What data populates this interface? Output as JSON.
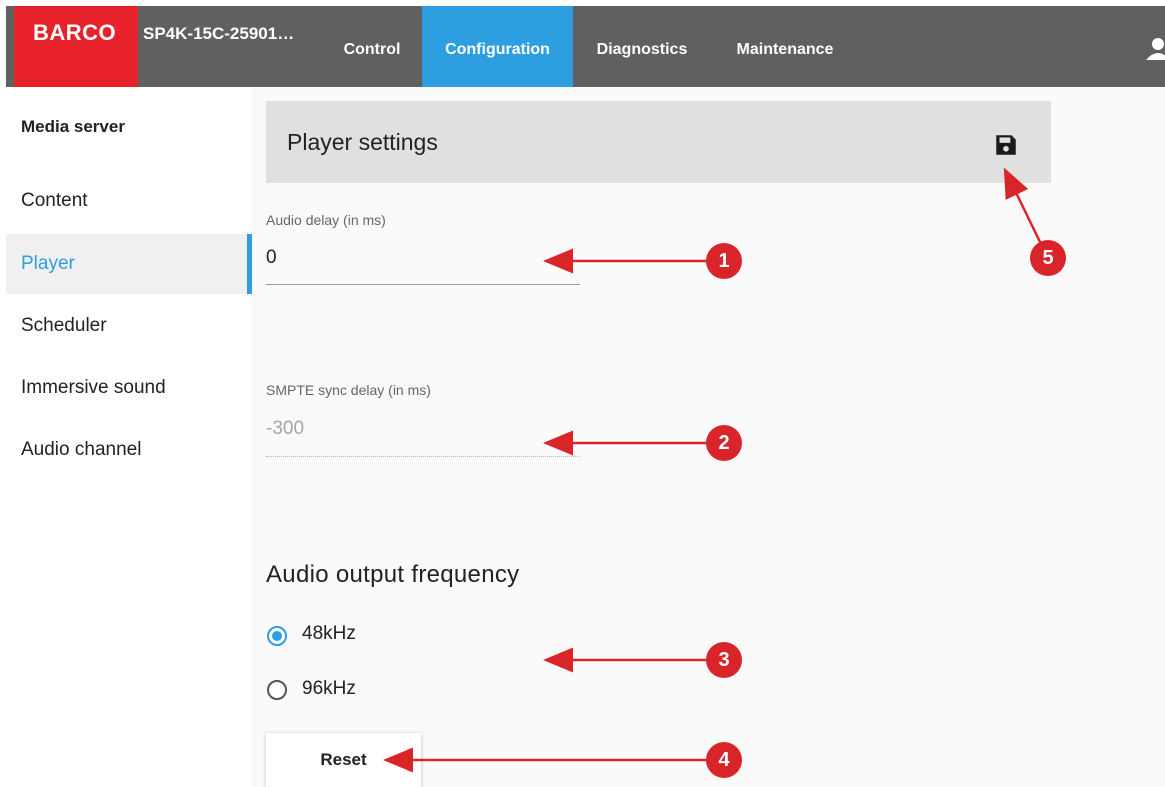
{
  "header": {
    "logo_text": "BARCO",
    "device_name": "SP4K-15C-25901…",
    "tabs": [
      {
        "label": "Control"
      },
      {
        "label": "Configuration"
      },
      {
        "label": "Diagnostics"
      },
      {
        "label": "Maintenance"
      }
    ],
    "active_tab": "Configuration",
    "user_icon": "user-icon"
  },
  "sidebar": {
    "section_title": "Media server",
    "items": [
      {
        "label": "Content"
      },
      {
        "label": "Player"
      },
      {
        "label": "Scheduler"
      },
      {
        "label": "Immersive sound"
      },
      {
        "label": "Audio channel"
      }
    ],
    "active_item": "Player"
  },
  "main": {
    "title": "Player settings",
    "save_icon": "save-icon",
    "audio_delay": {
      "label": "Audio delay (in ms)",
      "value": "0"
    },
    "smpte_delay": {
      "label": "SMPTE sync delay (in ms)",
      "value": "-300"
    },
    "frequency_title": "Audio output frequency",
    "frequency_options": [
      {
        "label": "48kHz",
        "checked": true
      },
      {
        "label": "96kHz",
        "checked": false
      }
    ],
    "reset_label": "Reset"
  },
  "callouts": [
    "1",
    "2",
    "3",
    "4",
    "5"
  ],
  "colors": {
    "accent": "#2d9ee0",
    "brand_red": "#e8222a",
    "topbar": "#606060",
    "callout_red": "#d9252a"
  }
}
